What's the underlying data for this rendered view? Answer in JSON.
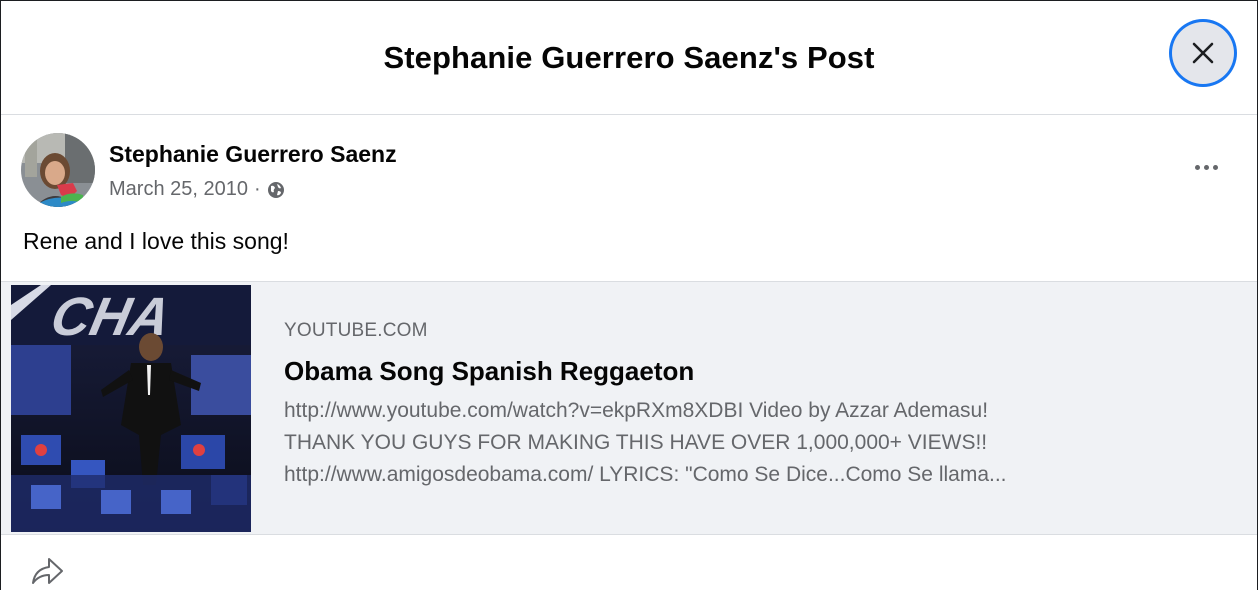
{
  "dialog": {
    "title": "Stephanie Guerrero Saenz's Post",
    "close_icon": "close-icon"
  },
  "post": {
    "author": "Stephanie Guerrero Saenz",
    "date": "March 25, 2010",
    "separator": "·",
    "privacy_icon": "globe-icon",
    "more_icon": "more-options-icon",
    "text": "Rene and I love this song!"
  },
  "link_preview": {
    "domain": "YOUTUBE.COM",
    "title": "Obama Song Spanish Reggaeton",
    "description_lines": [
      "http://www.youtube.com/watch?v=ekpRXm8XDBI Video by Azzar Ademasu!",
      "THANK YOU GUYS FOR MAKING THIS HAVE OVER 1,000,000+ VIEWS!!",
      "http://www.amigosdeobama.com/ LYRICS: \"Como Se Dice...Como Se llama..."
    ],
    "thumbnail_text": "CHA"
  },
  "actions": {
    "share_icon": "share-icon"
  },
  "colors": {
    "text_primary": "#050505",
    "text_secondary": "#65676b",
    "card_background": "#f0f2f5",
    "focus_ring": "#1877f2",
    "close_button_bg": "#e4e6eb"
  }
}
